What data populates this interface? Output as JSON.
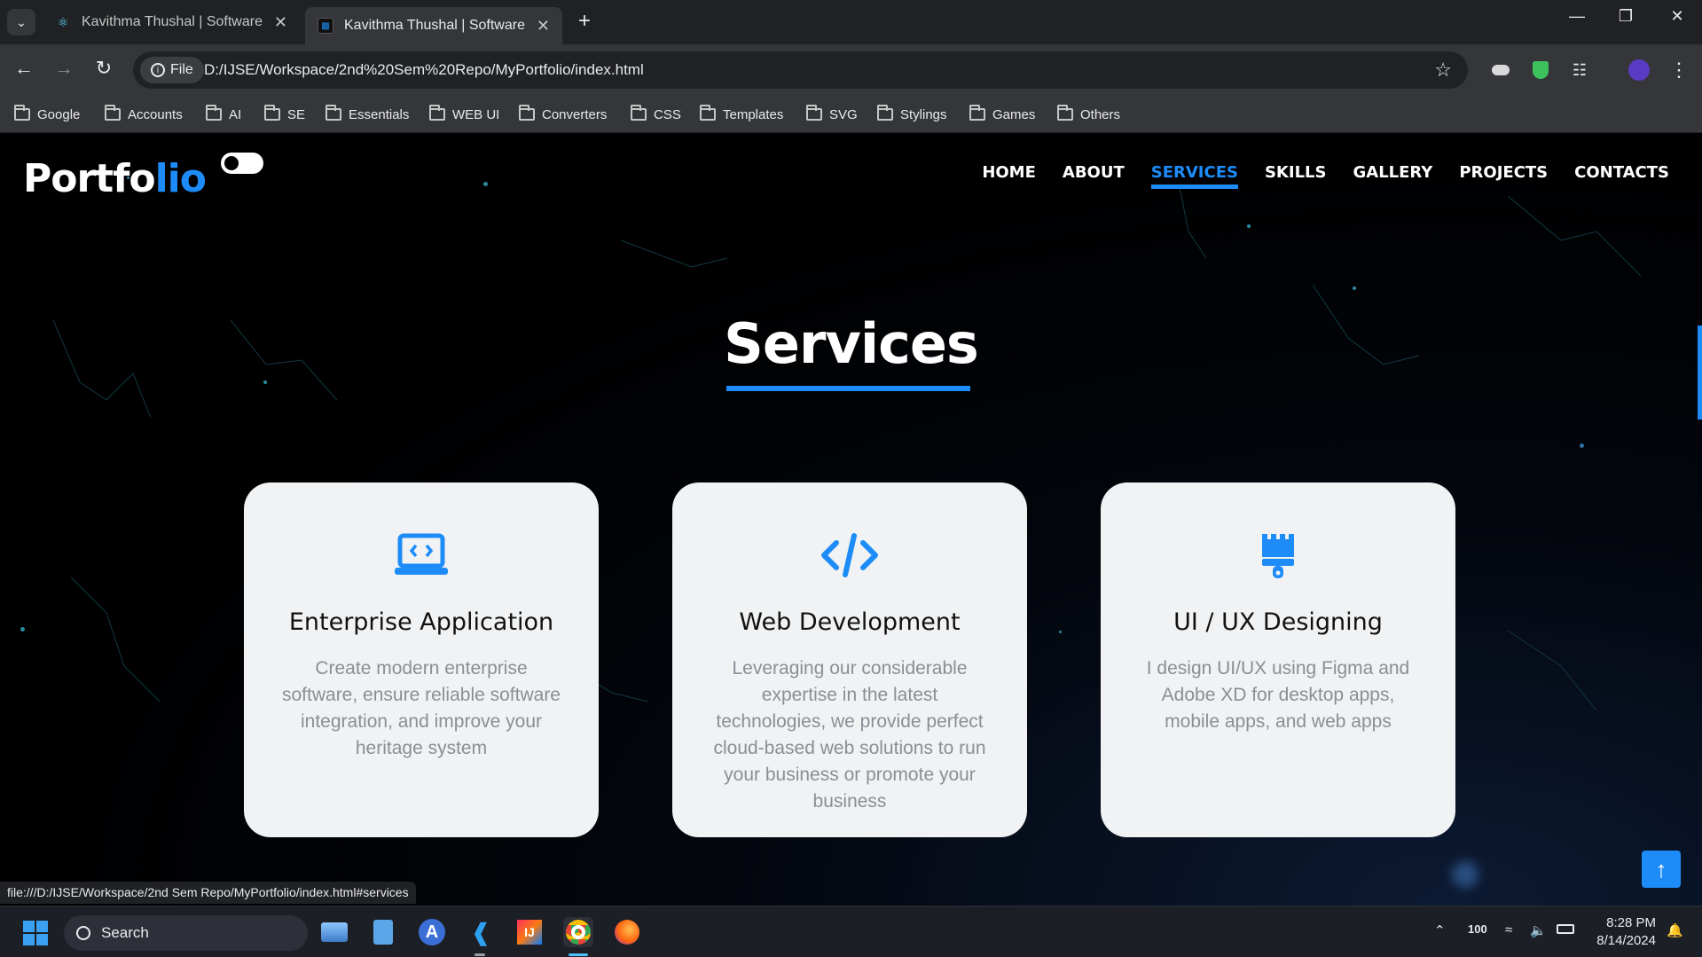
{
  "browser": {
    "tabs": [
      {
        "title": "Kavithma Thushal | Software En",
        "active": false,
        "favicon": "react-icon"
      },
      {
        "title": "Kavithma Thushal | Software En",
        "active": true,
        "favicon": "site-icon"
      }
    ],
    "omnibox": {
      "chip_label": "File",
      "url": "D:/IJSE/Workspace/2nd%20Sem%20Repo/MyPortfolio/index.html"
    },
    "bookmarks": [
      "Google",
      "Accounts",
      "AI",
      "SE",
      "Essentials",
      "WEB UI",
      "Converters",
      "CSS",
      "Templates",
      "SVG",
      "Stylings",
      "Games",
      "Others"
    ]
  },
  "page": {
    "logo_text": "Portfo",
    "logo_accent": "lio",
    "nav": [
      "HOME",
      "ABOUT",
      "SERVICES",
      "SKILLS",
      "GALLERY",
      "PROJECTS",
      "CONTACTS"
    ],
    "active_nav": "SERVICES",
    "section_title": "Services",
    "services": [
      {
        "icon": "laptop-code-icon",
        "title": "Enterprise Application",
        "desc": "Create modern enterprise software, ensure reliable software integration, and improve your heritage system"
      },
      {
        "icon": "code-icon",
        "title": "Web Development",
        "desc": "Leveraging our considerable expertise in the latest technologies, we provide perfect cloud-based web solutions to run your business or promote your business"
      },
      {
        "icon": "paint-brush-icon",
        "title": "UI / UX Designing",
        "desc": "I design UI/UX using Figma and Adobe XD for desktop apps, mobile apps, and web apps"
      }
    ],
    "status_url": "file:///D:/IJSE/Workspace/2nd Sem Repo/MyPortfolio/index.html#services",
    "accent_color": "#1d8cf8"
  },
  "taskbar": {
    "search_label": "Search",
    "battery_percent": "100",
    "time": "8:28 PM",
    "date": "8/14/2024"
  }
}
